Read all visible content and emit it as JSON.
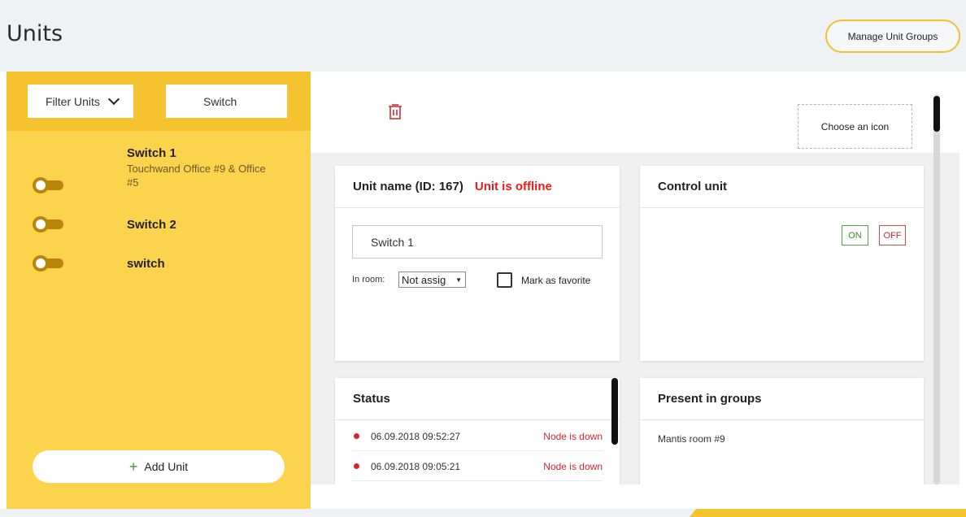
{
  "header": {
    "title": "Units",
    "manage_groups_label": "Manage Unit Groups"
  },
  "sidebar": {
    "filter_label": "Filter Units",
    "search_value": "Switch",
    "units": [
      {
        "name": "Switch 1",
        "location": "Touchwand Office #9 & Office #5"
      },
      {
        "name": "Switch 2",
        "location": ""
      },
      {
        "name": "switch",
        "location": ""
      }
    ],
    "add_unit_label": "Add Unit",
    "add_unit_icon": "plus-icon"
  },
  "main": {
    "delete_icon": "trash-icon",
    "choose_icon_label": "Choose an icon",
    "unit_card": {
      "title": "Unit name (ID: 167)",
      "offline_label": "Unit is offline",
      "name_value": "Switch 1",
      "room_label": "In room:",
      "room_value": "Not assig",
      "favorite_label": "Mark as favorite"
    },
    "control_card": {
      "title": "Control unit",
      "on_label": "ON",
      "off_label": "OFF"
    },
    "status_card": {
      "title": "Status",
      "rows": [
        {
          "time": "06.09.2018 09:52:27",
          "message": "Node is down"
        },
        {
          "time": "06.09.2018 09:05:21",
          "message": "Node is down"
        }
      ]
    },
    "groups_card": {
      "title": "Present in groups",
      "groups": [
        "Mantis room #9"
      ]
    }
  },
  "colors": {
    "accent_yellow": "#f5c32f",
    "sidebar_bg": "#fcd34d",
    "offline_red": "#e51d1d",
    "on_green": "#3c8a2c",
    "off_red": "#c62b2b"
  }
}
